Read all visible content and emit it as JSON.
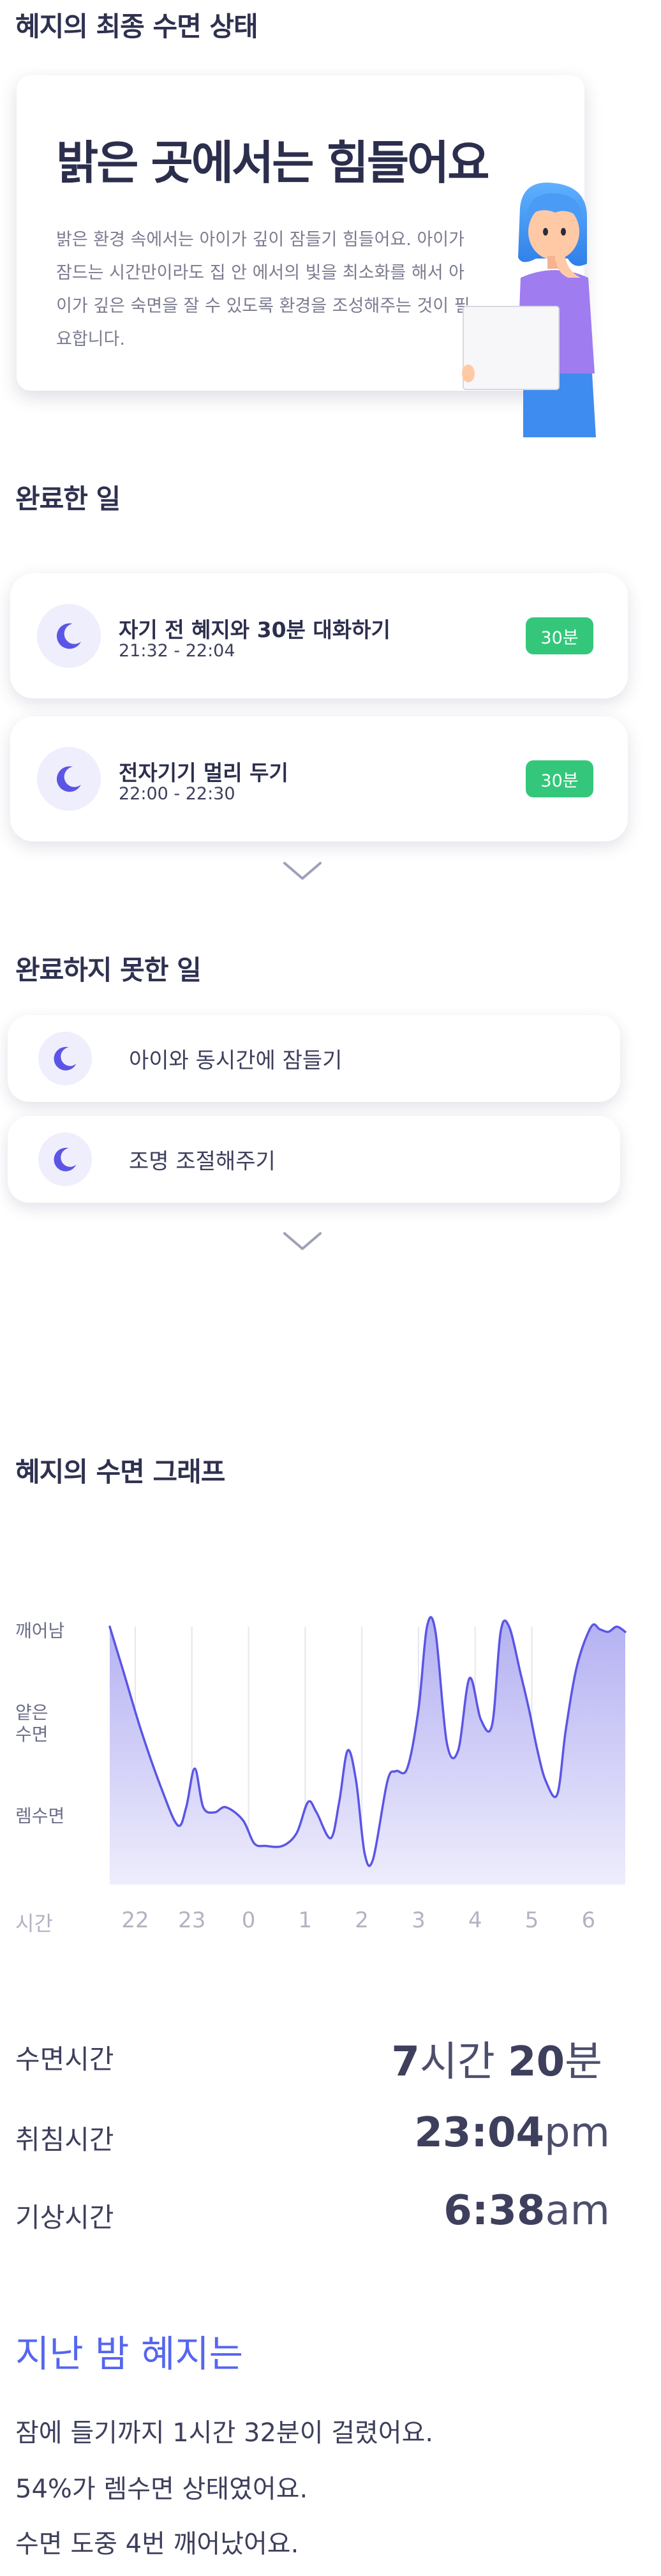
{
  "status": {
    "section_title": "혜지의 최종 수면 상태",
    "headline": "밝은 곳에서는 힘들어요",
    "description": "밝은 환경 속에서는 아이가 깊이 잠들기 힘들어요. 아이가 잠드는 시간만이라도 집 안 에서의 빛을 최소화를 해서 아이가 깊은 숙면을 잘 수 있도록 환경을 조성해주는 것이 필요합니다."
  },
  "completed": {
    "section_title": "완료한 일",
    "tasks": [
      {
        "title": "자기 전 혜지와 30분 대화하기",
        "time": "21:32 - 22:04",
        "duration": "30분"
      },
      {
        "title": "전자기기 멀리 두기",
        "time": "22:00 - 22:30",
        "duration": "30분"
      }
    ]
  },
  "incomplete": {
    "section_title": "완료하지 못한 일",
    "tasks": [
      {
        "label": "아이와 동시간에 잠들기"
      },
      {
        "label": "조명 조절해주기"
      }
    ]
  },
  "graph": {
    "section_title": "혜지의 수면 그래프"
  },
  "chart_data": {
    "type": "area",
    "title": "",
    "xlabel": "시간",
    "ylabel": "",
    "y_categories": [
      "렘수면",
      "얕은 수면",
      "깨어남"
    ],
    "x_ticks": [
      "22",
      "23",
      "0",
      "1",
      "2",
      "3",
      "4",
      "5",
      "6"
    ],
    "x_range": [
      21.55,
      30.65
    ],
    "y_range": [
      0,
      100
    ],
    "series": [
      {
        "x": [
          21.55,
          21.8,
          22.1,
          22.45,
          22.75,
          22.9,
          23.05,
          23.2,
          23.4,
          23.6,
          23.9,
          24.1,
          24.3,
          24.6,
          24.85,
          25.05,
          25.2,
          25.45,
          25.6,
          25.75,
          25.9,
          26.05,
          26.2,
          26.45,
          26.6,
          26.8,
          27.0,
          27.15,
          27.3,
          27.5,
          27.7,
          27.9,
          28.1,
          28.3,
          28.45,
          28.6,
          28.8,
          28.95,
          29.1,
          29.25,
          29.45,
          29.6,
          29.8,
          30.05,
          30.2,
          30.35,
          30.5,
          30.65
        ],
        "y": [
          100,
          82,
          60,
          38,
          23,
          30,
          45,
          30,
          28,
          30,
          25,
          16,
          15,
          15,
          20,
          32,
          28,
          18,
          32,
          52,
          40,
          12,
          10,
          40,
          44,
          45,
          68,
          100,
          98,
          55,
          52,
          80,
          64,
          62,
          98,
          100,
          82,
          68,
          52,
          40,
          35,
          60,
          85,
          100,
          99,
          98,
          100,
          98
        ]
      }
    ],
    "colors": {
      "line": "#5b55e6",
      "fill_top": "#b3b0f2",
      "fill_bottom": "#eeedfc"
    },
    "grid": true
  },
  "stats": {
    "sleep_time": {
      "label": "수면시간",
      "hours": "7",
      "hours_unit": "시간",
      "minutes": "20",
      "minutes_unit": "분"
    },
    "bed_time": {
      "label": "취침시간",
      "value": "23:04",
      "suffix": "pm"
    },
    "wake_time": {
      "label": "기상시간",
      "value": "6:38",
      "suffix": "am"
    }
  },
  "summary": {
    "title": "지난 밤 혜지는",
    "lines": [
      "잠에 들기까지 1시간 32분이 걸렸어요.",
      "54%가 렘수면 상태였어요.",
      "수면 도중 4번 깨어났어요."
    ]
  },
  "colors": {
    "accent": "#5566f0",
    "badge_green": "#34c77b",
    "moon": "#5b55e6"
  },
  "icons": {
    "task_icon": "moon-icon",
    "expand_icon": "chevron-down-icon"
  }
}
